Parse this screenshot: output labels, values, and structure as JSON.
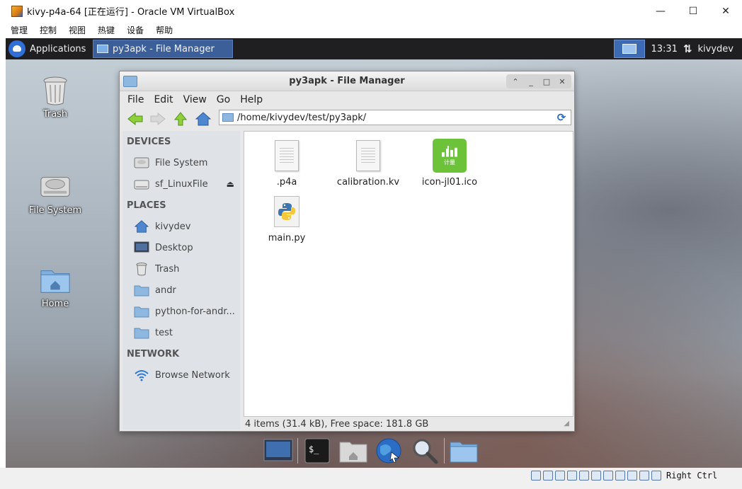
{
  "host": {
    "title": "kivy-p4a-64 [正在运行] - Oracle VM VirtualBox",
    "window_buttons": {
      "minimize": "—",
      "maximize": "☐",
      "close": "✕"
    },
    "menu": [
      "管理",
      "控制",
      "视图",
      "热键",
      "设备",
      "帮助"
    ],
    "statusbar": {
      "host_key": "Right Ctrl"
    }
  },
  "panel": {
    "applications_label": "Applications",
    "task_label": "py3apk - File Manager",
    "clock": "13:31",
    "network_glyph": "⇅",
    "user": "kivydev"
  },
  "desktop": {
    "icons": [
      {
        "label": "Trash",
        "icon": "trash-icon"
      },
      {
        "label": "File System",
        "icon": "drive-icon"
      },
      {
        "label": "Home",
        "icon": "home-folder-icon"
      }
    ]
  },
  "file_manager": {
    "title": "py3apk - File Manager",
    "window_buttons": {
      "up": "⌃",
      "minimize": "_",
      "maximize": "□",
      "close": "✕"
    },
    "menu": [
      "File",
      "Edit",
      "View",
      "Go",
      "Help"
    ],
    "path": "/home/kivydev/test/py3apk/",
    "sidebar": {
      "devices_heading": "DEVICES",
      "devices": [
        "File System",
        "sf_LinuxFile"
      ],
      "places_heading": "PLACES",
      "places": [
        "kivydev",
        "Desktop",
        "Trash",
        "andr",
        "python-for-andr...",
        "test"
      ],
      "network_heading": "NETWORK",
      "network": [
        "Browse Network"
      ]
    },
    "files": [
      {
        "name": ".p4a",
        "icon": "text-file-icon"
      },
      {
        "name": "calibration.kv",
        "icon": "text-file-icon"
      },
      {
        "name": "icon-jl01.ico",
        "icon": "image-file-icon"
      },
      {
        "name": "main.py",
        "icon": "python-file-icon"
      }
    ],
    "ico_caption": "计量",
    "status": "4 items (31.4 kB), Free space: 181.8 GB"
  },
  "dock": [
    "screen-icon",
    "terminal-icon",
    "home-icon",
    "browser-icon",
    "search-icon",
    "folder-icon"
  ],
  "colors": {
    "panel_bg": "#1f1f22",
    "task_active": "#3c5f9a",
    "ico_green": "#6cc33a",
    "folder_blue": "#8fb8e0"
  }
}
